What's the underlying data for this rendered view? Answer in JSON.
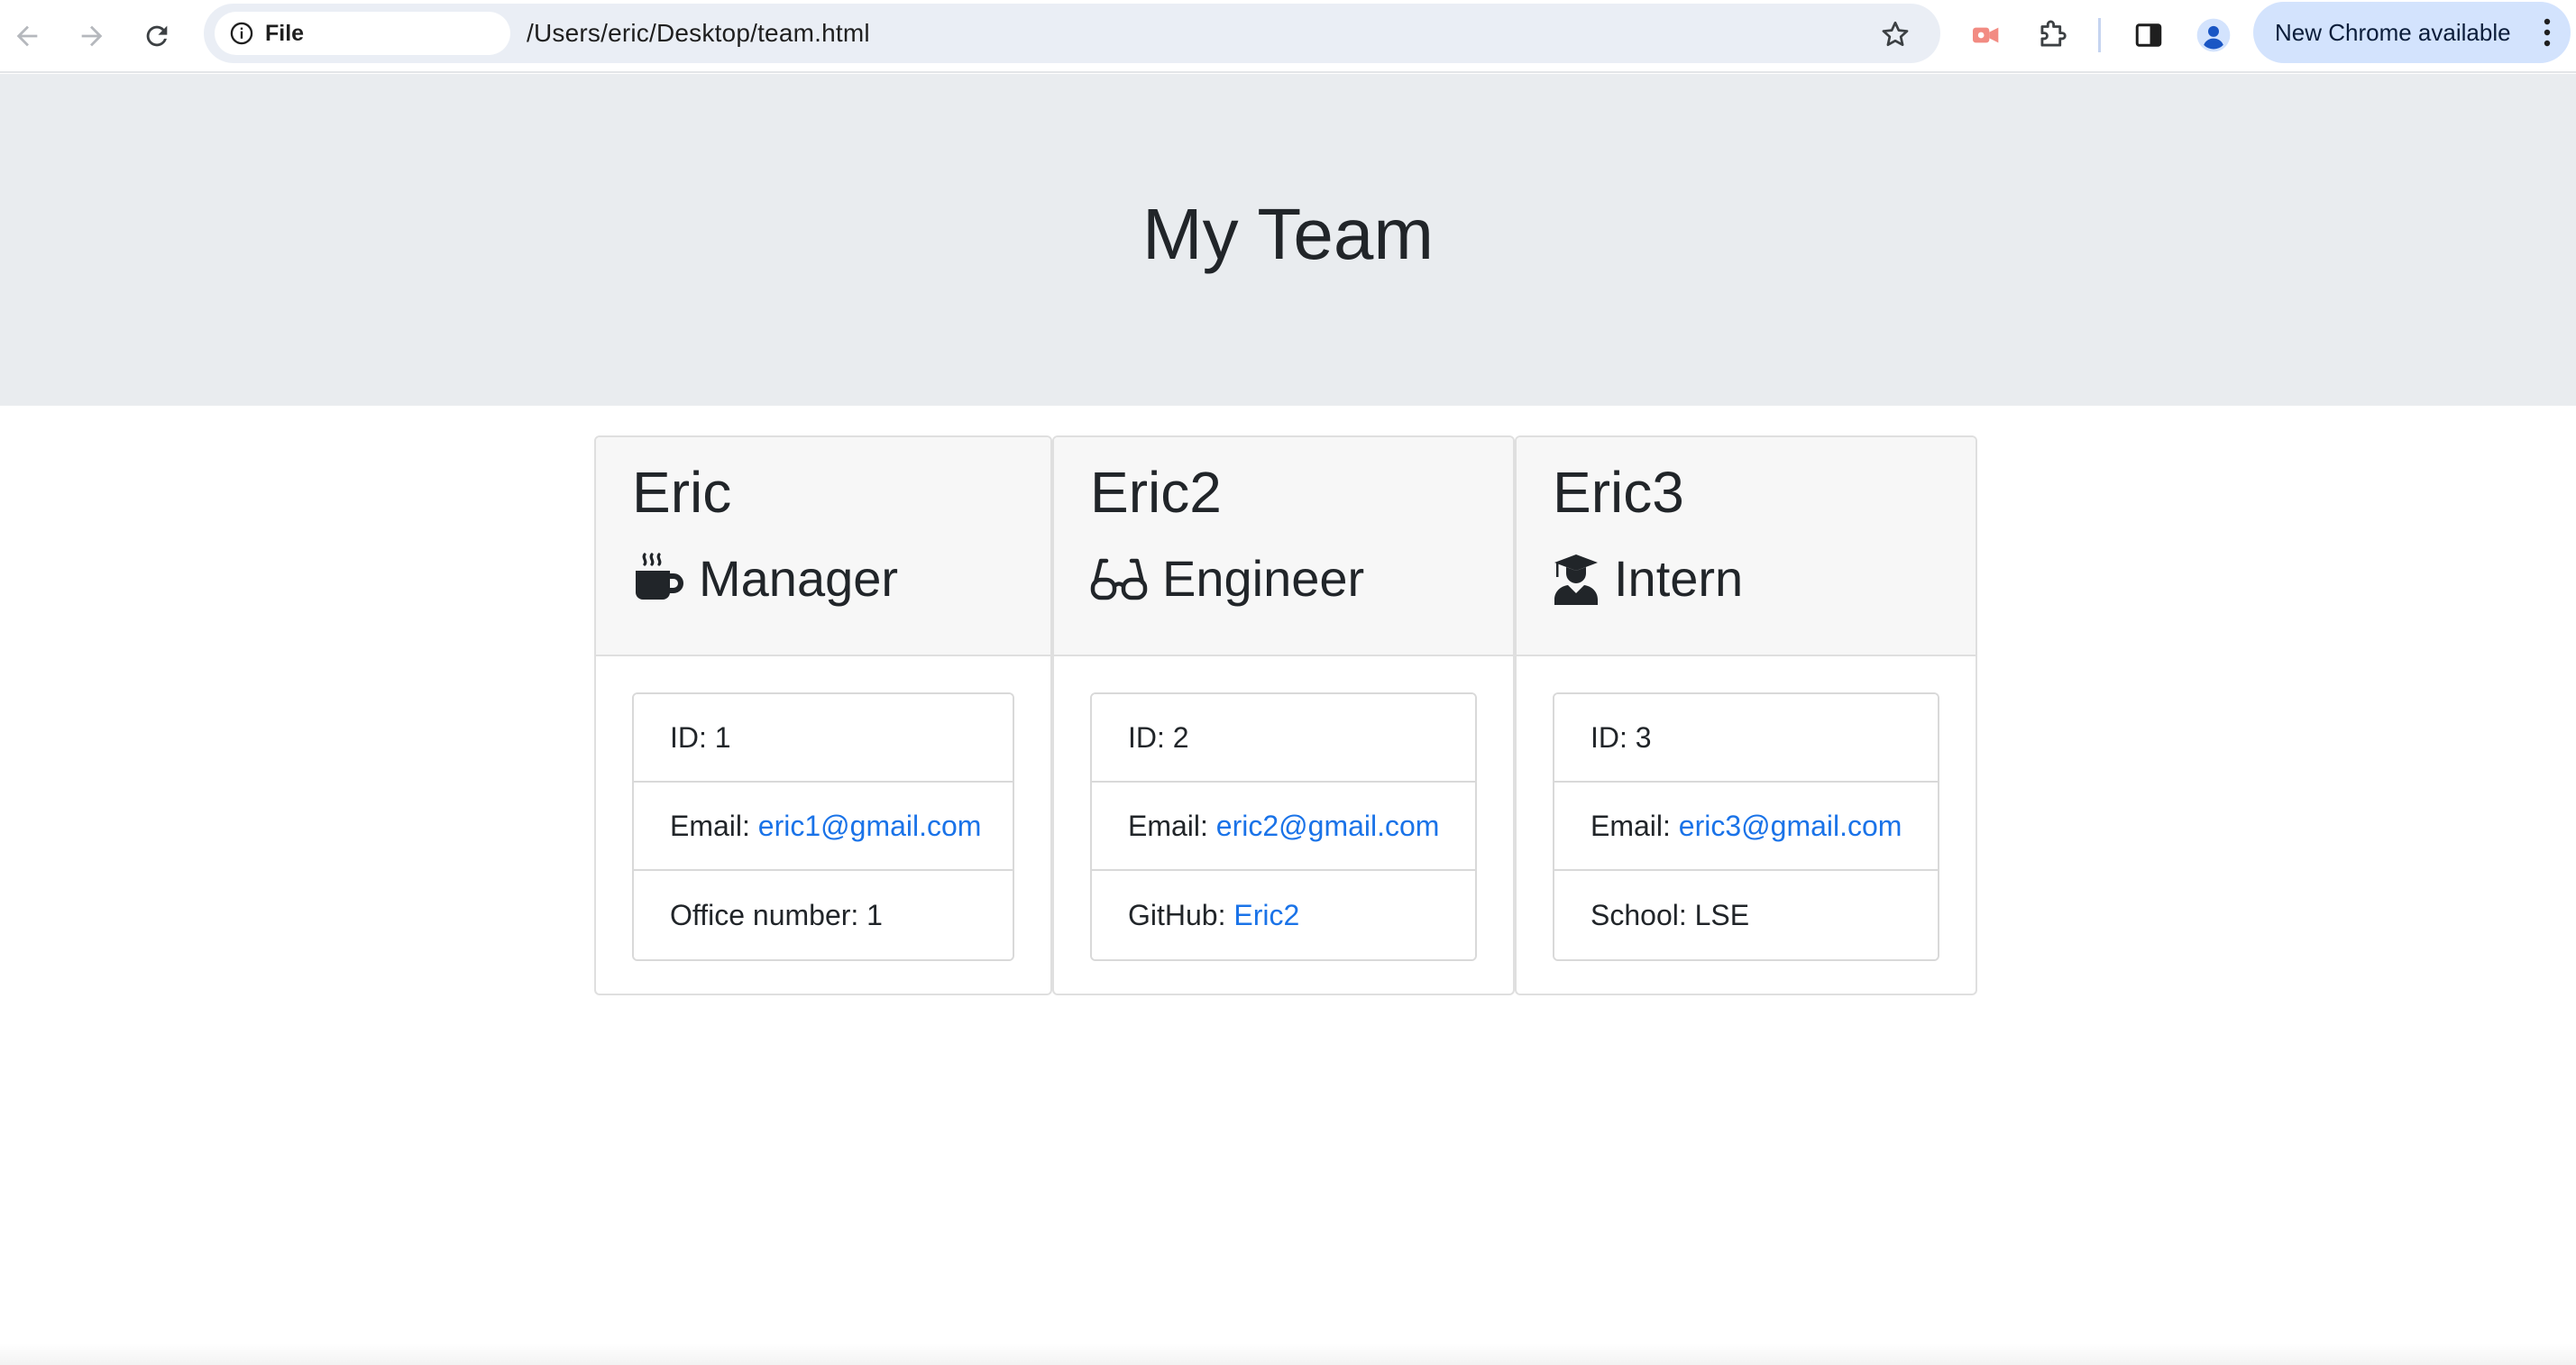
{
  "browser": {
    "back_icon": "arrow-left-icon",
    "forward_icon": "arrow-right-icon",
    "reload_icon": "reload-icon",
    "site_info_label": "File",
    "url": "/Users/eric/Desktop/team.html",
    "bookmark_icon": "star-icon",
    "update_label": "New Chrome available",
    "accent_color": "#d3e3fd",
    "link_color": "#1a73e8"
  },
  "page": {
    "title": "My Team"
  },
  "team": [
    {
      "name": "Eric",
      "role": "Manager",
      "role_icon": "coffee-mug-icon",
      "details": [
        {
          "label": "ID: ",
          "value": "1",
          "is_link": false
        },
        {
          "label": "Email: ",
          "value": "eric1@gmail.com",
          "is_link": true
        },
        {
          "label": "Office number: ",
          "value": "1",
          "is_link": false
        }
      ]
    },
    {
      "name": "Eric2",
      "role": "Engineer",
      "role_icon": "glasses-icon",
      "details": [
        {
          "label": "ID: ",
          "value": "2",
          "is_link": false
        },
        {
          "label": "Email: ",
          "value": "eric2@gmail.com",
          "is_link": true
        },
        {
          "label": "GitHub: ",
          "value": "Eric2",
          "is_link": true
        }
      ]
    },
    {
      "name": "Eric3",
      "role": "Intern",
      "role_icon": "graduate-icon",
      "details": [
        {
          "label": "ID: ",
          "value": "3",
          "is_link": false
        },
        {
          "label": "Email: ",
          "value": "eric3@gmail.com",
          "is_link": true
        },
        {
          "label": "School: ",
          "value": "LSE",
          "is_link": false
        }
      ]
    }
  ]
}
